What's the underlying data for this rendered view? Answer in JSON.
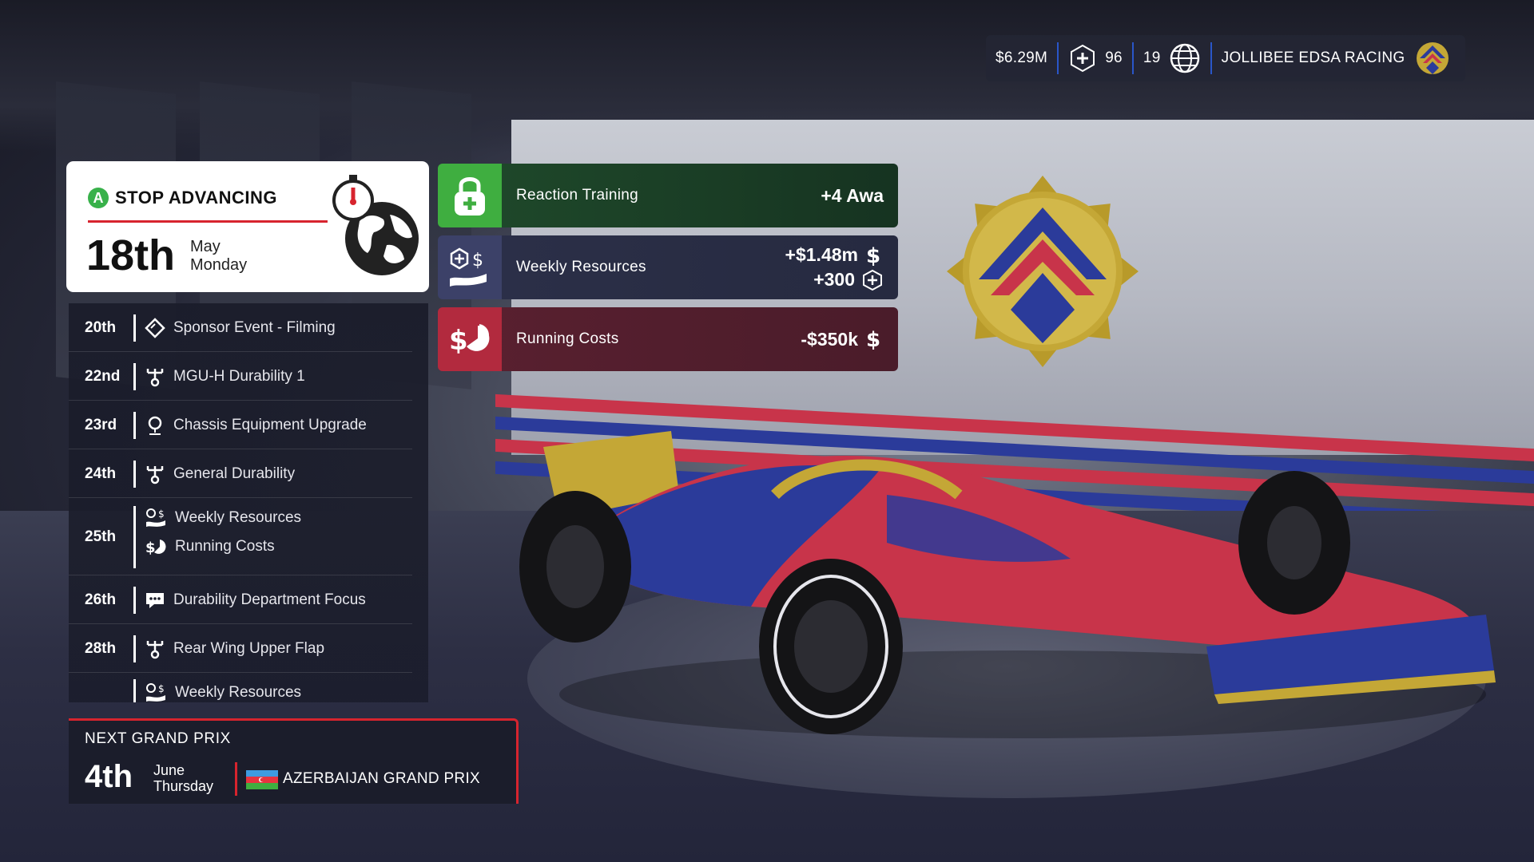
{
  "topbar": {
    "money": "$6.29M",
    "research_points": "96",
    "nineteen": "19",
    "team_name": "JOLLIBEE EDSA RACING"
  },
  "current": {
    "action_button": "A",
    "action_label": "STOP ADVANCING",
    "day": "18th",
    "month": "May",
    "weekday": "Monday"
  },
  "events": [
    {
      "day": "20th",
      "items": [
        {
          "icon": "sponsor-diamond-icon",
          "label": "Sponsor Event - Filming"
        }
      ]
    },
    {
      "day": "22nd",
      "items": [
        {
          "icon": "engineering-tree-icon",
          "label": "MGU-H Durability 1"
        }
      ]
    },
    {
      "day": "23rd",
      "items": [
        {
          "icon": "location-pin-icon",
          "label": "Chassis Equipment Upgrade"
        }
      ]
    },
    {
      "day": "24th",
      "items": [
        {
          "icon": "engineering-tree-icon",
          "label": "General Durability"
        }
      ]
    },
    {
      "day": "25th",
      "items": [
        {
          "icon": "weekly-resources-icon",
          "label": "Weekly Resources"
        },
        {
          "icon": "running-costs-icon",
          "label": "Running Costs"
        }
      ]
    },
    {
      "day": "26th",
      "items": [
        {
          "icon": "chat-bubble-icon",
          "label": "Durability Department Focus"
        }
      ]
    },
    {
      "day": "28th",
      "items": [
        {
          "icon": "engineering-tree-icon",
          "label": "Rear Wing Upper Flap"
        }
      ]
    },
    {
      "day": "",
      "items": [
        {
          "icon": "weekly-resources-icon",
          "label": "Weekly Resources"
        }
      ]
    }
  ],
  "next_gp": {
    "label": "NEXT GRAND PRIX",
    "day": "4th",
    "month": "June",
    "weekday": "Thursday",
    "name": "AZERBAIJAN GRAND PRIX"
  },
  "notifications": [
    {
      "title": "Reaction Training",
      "value": "+4 Awa"
    },
    {
      "title": "Weekly Resources",
      "value": "+$1.48m",
      "value2": "+300"
    },
    {
      "title": "Running Costs",
      "value": "-$350k"
    }
  ],
  "colors": {
    "accent_red": "#d7242e",
    "accent_green": "#3fae40",
    "accent_blue": "#2a56c9"
  }
}
